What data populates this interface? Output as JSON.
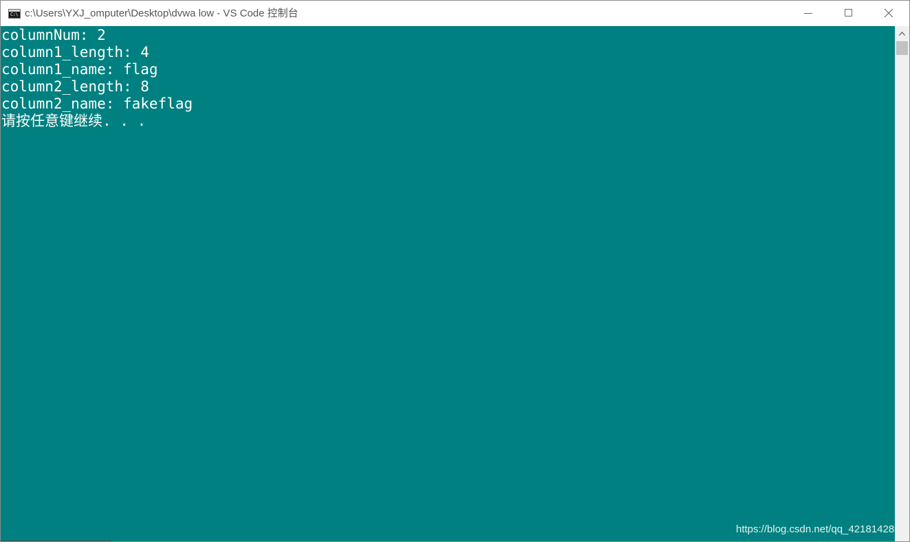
{
  "window": {
    "title": "c:\\Users\\YXJ_omputer\\Desktop\\dvwa low - VS Code 控制台",
    "app_icon_label": "C:\\",
    "controls": {
      "minimize_icon": "minimize-icon",
      "maximize_icon": "maximize-icon",
      "close_icon": "close-icon"
    }
  },
  "console": {
    "background_color": "#008080",
    "text_color": "#ffffff",
    "lines": [
      "columnNum: 2",
      "column1_length: 4",
      "column1_name: flag",
      "column2_length: 8",
      "column2_name: fakeflag",
      "请按任意键继续. . ."
    ]
  },
  "watermark": "https://blog.csdn.net/qq_42181428"
}
